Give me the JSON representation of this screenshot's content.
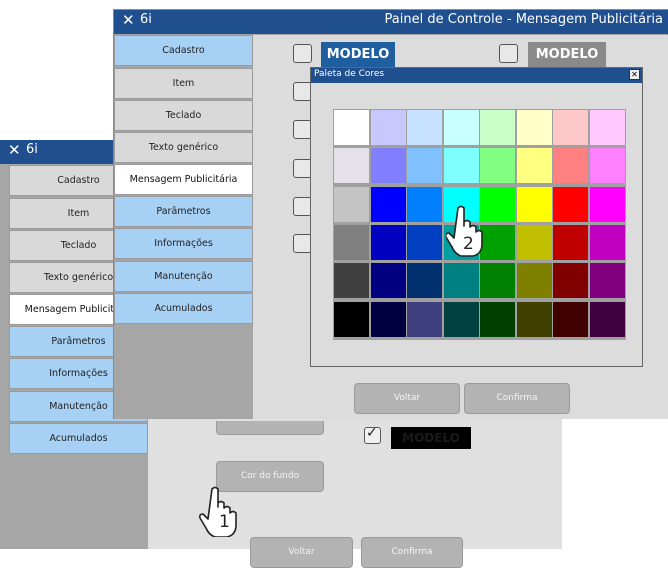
{
  "back_window": {
    "close_glyph": "✕",
    "app_name": "6i",
    "menu": [
      {
        "label": "Cadastro",
        "state": "dim"
      },
      {
        "label": "Item",
        "state": "dim"
      },
      {
        "label": "Teclado",
        "state": "dim"
      },
      {
        "label": "Texto genérico",
        "state": "dim"
      },
      {
        "label": "Mensagem Publicitária",
        "state": "selected"
      },
      {
        "label": "Parâmetros",
        "state": "normal"
      },
      {
        "label": "Informações",
        "state": "normal"
      },
      {
        "label": "Manutenção",
        "state": "normal"
      },
      {
        "label": "Acumulados",
        "state": "normal"
      }
    ],
    "preview_text": "MODELO",
    "preview_checked": true,
    "bg_color_button": "Cor do fundo",
    "back_button": "Voltar",
    "confirm_button": "Confirma",
    "step_label": "1"
  },
  "front_window": {
    "close_glyph": "✕",
    "app_name": "6i",
    "title": "Painel de Controle - Mensagem Publicitária",
    "menu": [
      {
        "label": "Cadastro",
        "state": "normal"
      },
      {
        "label": "Item",
        "state": "dim"
      },
      {
        "label": "Teclado",
        "state": "dim"
      },
      {
        "label": "Texto genérico",
        "state": "dim"
      },
      {
        "label": "Mensagem Publicitária",
        "state": "selected"
      },
      {
        "label": "Parâmetros",
        "state": "normal"
      },
      {
        "label": "Informações",
        "state": "normal"
      },
      {
        "label": "Manutenção",
        "state": "normal"
      },
      {
        "label": "Acumulados",
        "state": "normal"
      }
    ],
    "modelo_1": {
      "text": "MODELO",
      "color": "#1f5f9f"
    },
    "modelo_2": {
      "text": "MODELO",
      "color": "#8a8a8a"
    },
    "back_button": "Voltar",
    "confirm_button": "Confirma"
  },
  "palette_dialog": {
    "title": "Paleta de Cores",
    "close_glyph": "✕",
    "step_label": "2",
    "colors": [
      [
        "#ffffff",
        "#c8c8ff",
        "#c6e2ff",
        "#c8ffff",
        "#c8ffc8",
        "#ffffc8",
        "#ffc8c8",
        "#ffc8ff"
      ],
      [
        "#e6e0e8",
        "#8080ff",
        "#80c0ff",
        "#80ffff",
        "#80ff80",
        "#ffff80",
        "#ff8080",
        "#ff80ff"
      ],
      [
        "#c4c4c4",
        "#0000ff",
        "#0080ff",
        "#00ffff",
        "#00ff00",
        "#ffff00",
        "#ff0000",
        "#ff00ff"
      ],
      [
        "#808080",
        "#0000c0",
        "#0040c0",
        "#00a0a0",
        "#00a000",
        "#c0c000",
        "#c00000",
        "#c000c0"
      ],
      [
        "#404040",
        "#000080",
        "#003070",
        "#008080",
        "#008000",
        "#808000",
        "#800000",
        "#800080"
      ],
      [
        "#000000",
        "#000040",
        "#404080",
        "#004040",
        "#004000",
        "#404000",
        "#400000",
        "#400040"
      ]
    ]
  }
}
